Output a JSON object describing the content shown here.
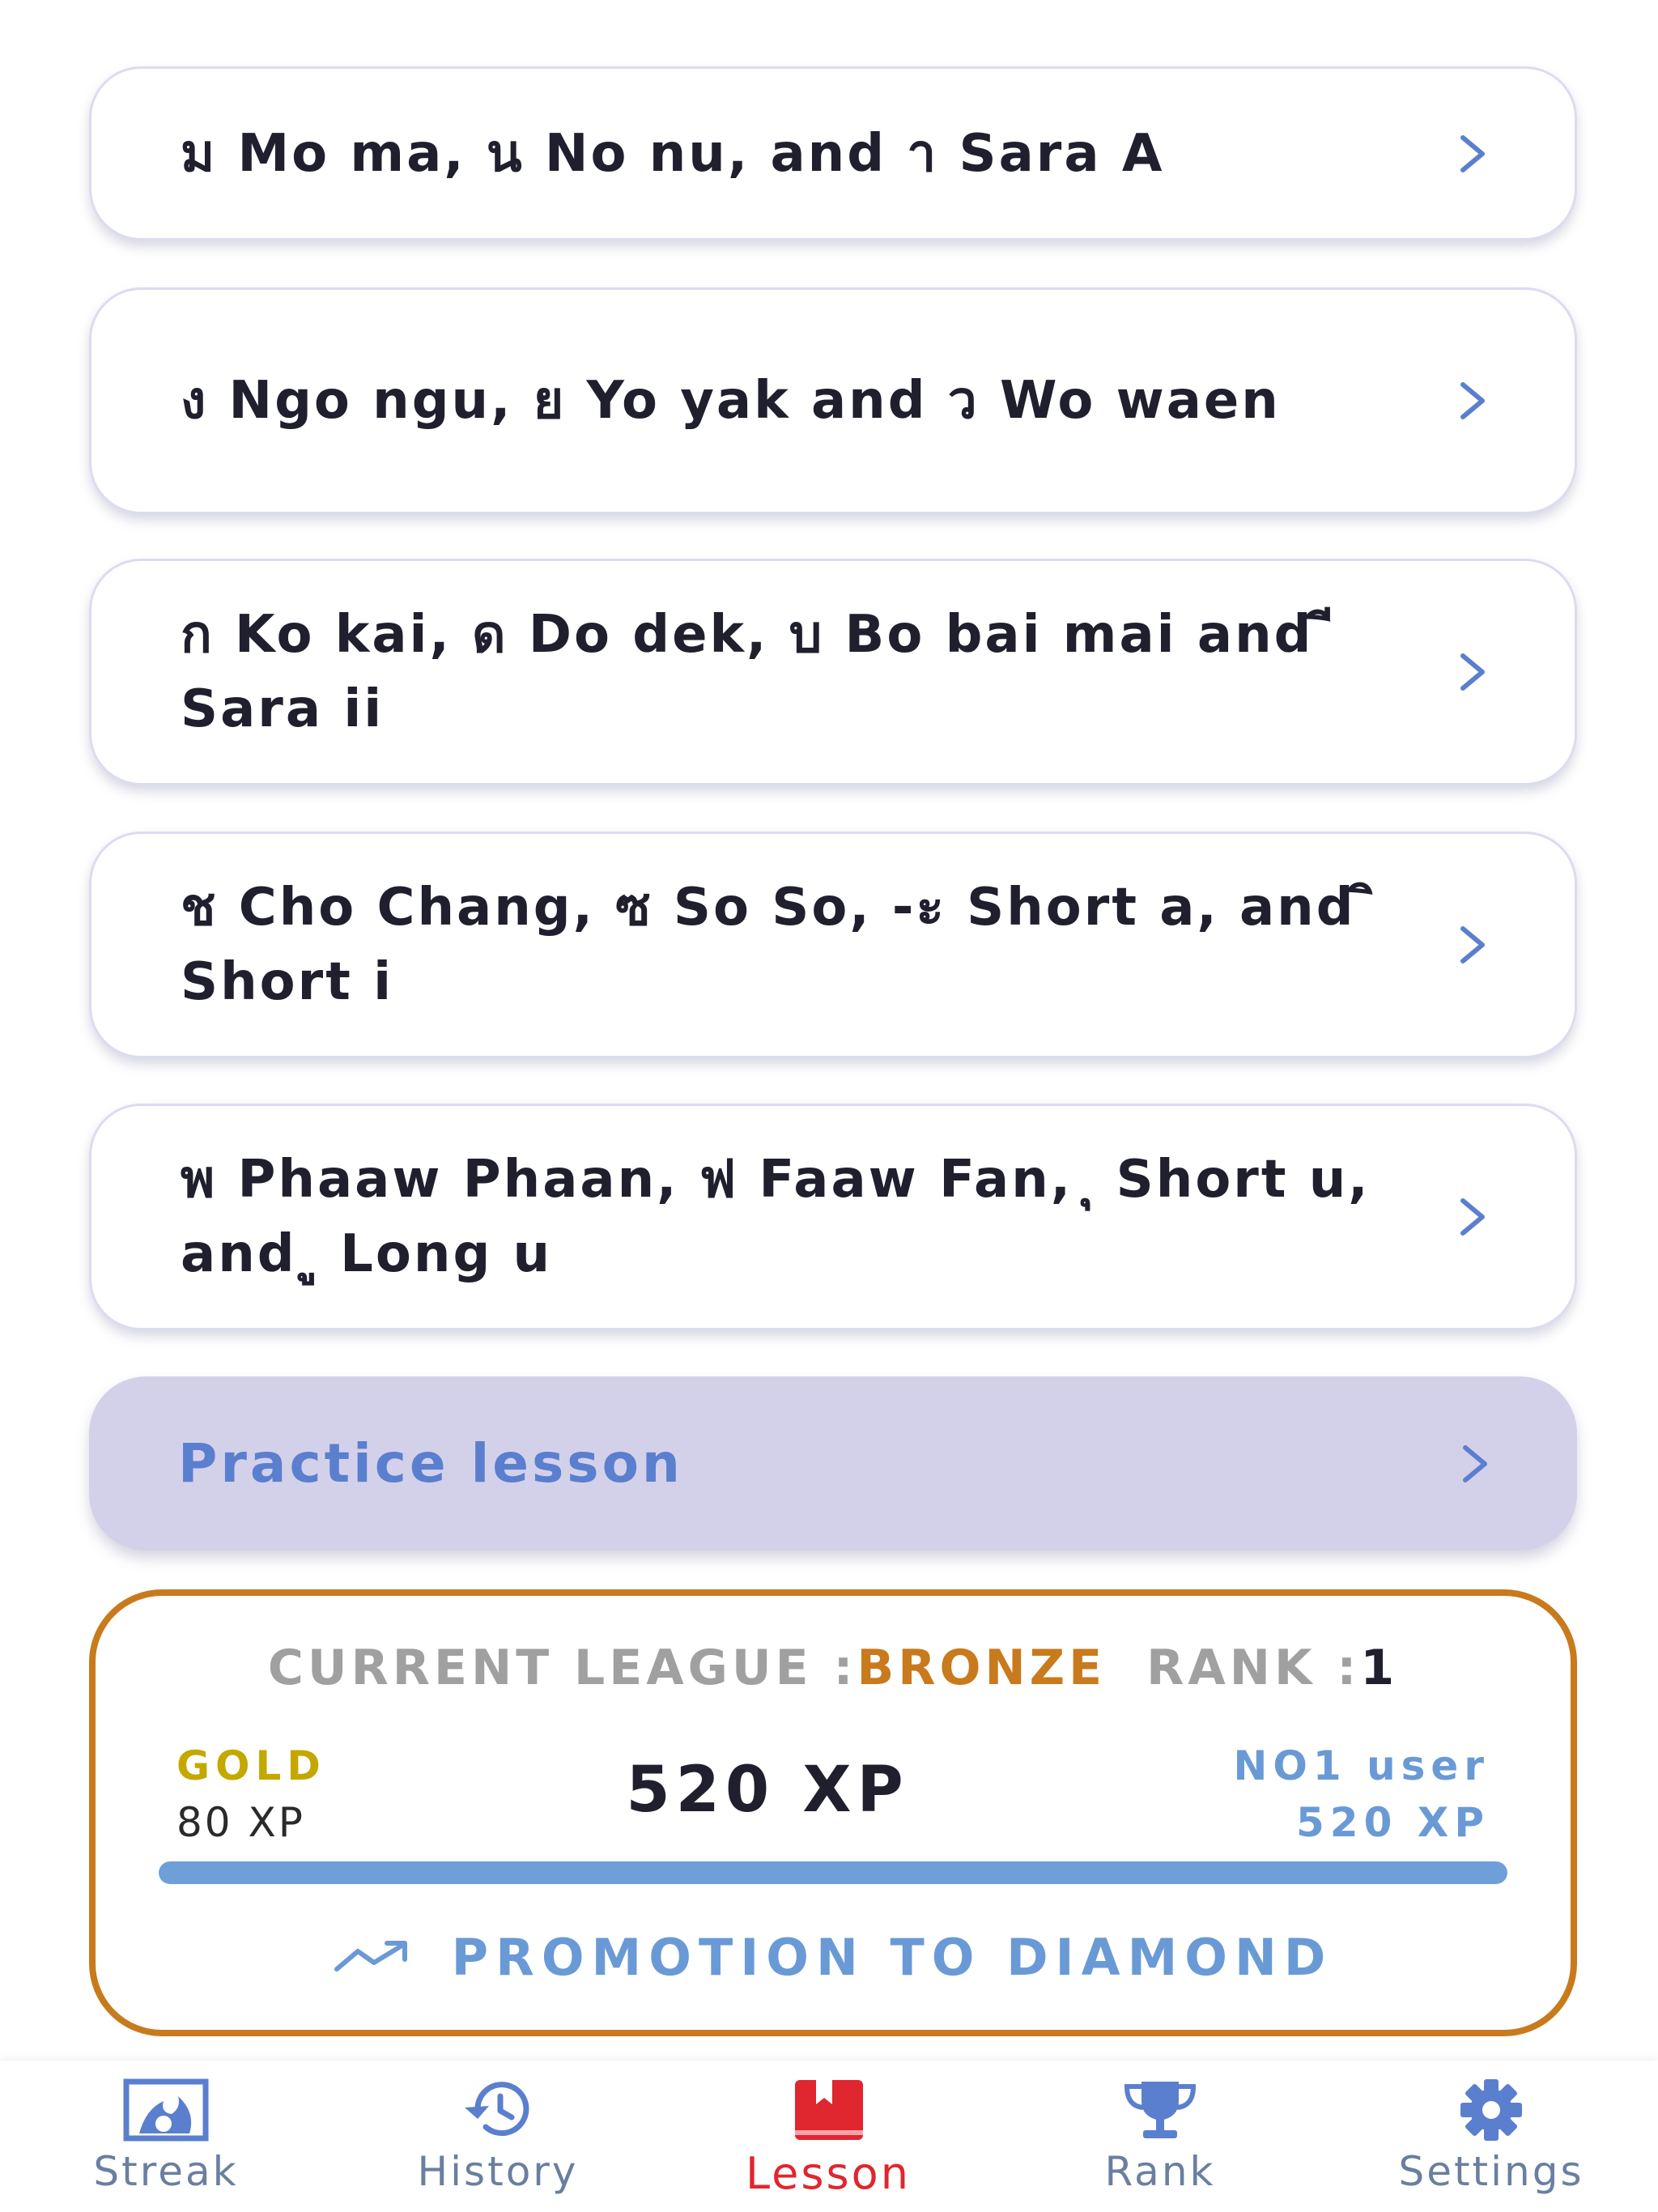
{
  "lessons": [
    {
      "title": "ม Mo ma, น No nu, and า Sara A"
    },
    {
      "title": "ง Ngo ngu, ย Yo yak and ว Wo waen"
    },
    {
      "title": "ก Ko kai, ด Do dek, บ Bo bai mai and ี Sara ii"
    },
    {
      "title": "ช Cho Chang, ซ So So, -ะ Short a, and ิ Short i"
    },
    {
      "title": "พ Phaaw Phaan, ฟ Faaw Fan, ุ Short u, and ู Long u"
    }
  ],
  "practice": {
    "title": "Practice lesson"
  },
  "league": {
    "label": "CURRENT LEAGUE :",
    "name": "BRONZE",
    "rank_label": "RANK :",
    "rank_value": "1",
    "gold_label": "GOLD",
    "gold_xp": "80 XP",
    "current_xp": "520 XP",
    "top_user_label": "NO1 user",
    "top_user_xp": "520 XP",
    "progress_fraction": 1.0,
    "promotion_text": "PROMOTION TO DIAMOND",
    "accent_color": "#c87a1c"
  },
  "nav": {
    "items": [
      {
        "label": "Streak",
        "icon": "streak-icon"
      },
      {
        "label": "History",
        "icon": "history-icon"
      },
      {
        "label": "Lesson",
        "icon": "lesson-icon",
        "active": true
      },
      {
        "label": "Rank",
        "icon": "trophy-icon"
      },
      {
        "label": "Settings",
        "icon": "gear-icon"
      }
    ],
    "active_color": "#e0262e",
    "inactive_color": "#6a7fa0"
  }
}
